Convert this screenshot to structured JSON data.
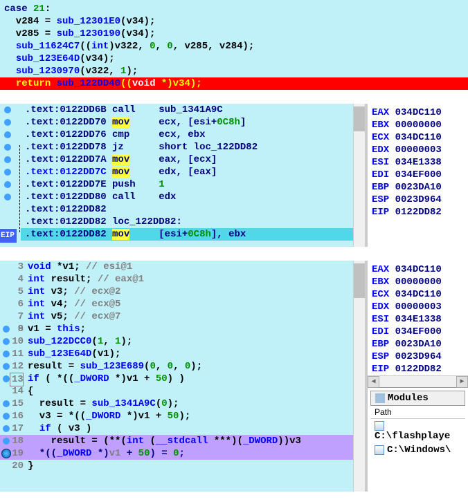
{
  "decompile_top": [
    {
      "tokens": [
        {
          "t": "case ",
          "c": "dblue"
        },
        {
          "t": "21",
          "c": "green"
        },
        {
          "t": ":",
          "c": "black"
        }
      ]
    },
    {
      "tokens": [
        {
          "t": "  v284 = ",
          "c": "black"
        },
        {
          "t": "sub_12301E0",
          "c": "blue"
        },
        {
          "t": "(v34);",
          "c": "black"
        }
      ]
    },
    {
      "tokens": [
        {
          "t": "  v285 = ",
          "c": "black"
        },
        {
          "t": "sub_1230190",
          "c": "blue"
        },
        {
          "t": "(v34);",
          "c": "black"
        }
      ]
    },
    {
      "tokens": [
        {
          "t": "  ",
          "c": "black"
        },
        {
          "t": "sub_11624C7",
          "c": "blue"
        },
        {
          "t": "((",
          "c": "black"
        },
        {
          "t": "int",
          "c": "blue"
        },
        {
          "t": ")v322, ",
          "c": "black"
        },
        {
          "t": "0",
          "c": "green"
        },
        {
          "t": ", ",
          "c": "black"
        },
        {
          "t": "0",
          "c": "green"
        },
        {
          "t": ", v285, v284);",
          "c": "black"
        }
      ]
    },
    {
      "tokens": [
        {
          "t": "  ",
          "c": "black"
        },
        {
          "t": "sub_123E64D",
          "c": "blue"
        },
        {
          "t": "(v34);",
          "c": "black"
        }
      ]
    },
    {
      "tokens": [
        {
          "t": "  ",
          "c": "black"
        },
        {
          "t": "sub_1230970",
          "c": "blue"
        },
        {
          "t": "(v322, ",
          "c": "black"
        },
        {
          "t": "1",
          "c": "green"
        },
        {
          "t": ");",
          "c": "black"
        }
      ]
    },
    {
      "tokens": [
        {
          "t": "  ",
          "c": "yellow",
          "hl": "hl-red"
        },
        {
          "t": "return ",
          "c": "yellow",
          "hl": "hl-red"
        },
        {
          "t": "sub_122DD40",
          "c": "blue",
          "hl": "hl-red"
        },
        {
          "t": "((",
          "c": "yellow",
          "hl": "hl-red"
        },
        {
          "t": "void ",
          "c": "white",
          "hl": "hl-red"
        },
        {
          "t": "*)v34);",
          "c": "yellow",
          "hl": "hl-red"
        }
      ],
      "full_hl": "hl-red"
    }
  ],
  "disasm": [
    {
      "addr": ".text:0122DD6B",
      "op": "call",
      "args": "sub_1341A9C",
      "bp": true
    },
    {
      "addr": ".text:0122DD70",
      "op": "mov",
      "hlop": true,
      "args": "ecx, [esi+",
      "suffix": "0C8h",
      "suffixc": "green",
      "end": "]",
      "bp": true
    },
    {
      "addr": ".text:0122DD76",
      "op": "cmp",
      "args": "ecx, ebx",
      "bp": true
    },
    {
      "addr": ".text:0122DD78",
      "op": "jz",
      "args": "short loc_122DD82",
      "bp": true,
      "jmp": true
    },
    {
      "addr": ".text:0122DD7A",
      "op": "mov",
      "hlop": true,
      "args": "eax, [ecx]",
      "bp": true
    },
    {
      "addr": ".text:0122DD7C",
      "op": "mov",
      "hlop": true,
      "args": "edx, [eax]",
      "bp": true,
      "blueaddr": true
    },
    {
      "addr": ".text:0122DD7E",
      "op": "push",
      "args": "1",
      "argsc": "green",
      "bp": true
    },
    {
      "addr": ".text:0122DD80",
      "op": "call",
      "args": "edx",
      "bp": true
    },
    {
      "addr": ".text:0122DD82",
      "plain": true
    },
    {
      "addr": ".text:0122DD82",
      "label": "loc_122DD82:",
      "arrow": true
    },
    {
      "addr": ".text:0122DD82",
      "op": "mov",
      "hlop": true,
      "args": "[esi+",
      "suffix": "0C8h",
      "suffixc": "green",
      "end": "], ebx",
      "line_hl": "hl-cyan",
      "eip": true
    }
  ],
  "registers_top": [
    {
      "n": "EAX",
      "v": "034DC110"
    },
    {
      "n": "EBX",
      "v": "00000000"
    },
    {
      "n": "ECX",
      "v": "034DC110"
    },
    {
      "n": "EDX",
      "v": "00000003"
    },
    {
      "n": "ESI",
      "v": "034E1338"
    },
    {
      "n": "EDI",
      "v": "034EF000"
    },
    {
      "n": "EBP",
      "v": "0023DA10"
    },
    {
      "n": "ESP",
      "v": "0023D964"
    },
    {
      "n": "EIP",
      "v": "0122DD82"
    }
  ],
  "decompile_bottom": [
    {
      "ln": "3",
      "tokens": [
        {
          "t": "void ",
          "c": "blue"
        },
        {
          "t": "*v1; ",
          "c": "black"
        },
        {
          "t": "// esi@1",
          "c": "gray"
        }
      ]
    },
    {
      "ln": "4",
      "tokens": [
        {
          "t": "int ",
          "c": "blue"
        },
        {
          "t": "result; ",
          "c": "black"
        },
        {
          "t": "// eax@1",
          "c": "gray"
        }
      ]
    },
    {
      "ln": "5",
      "tokens": [
        {
          "t": "int ",
          "c": "blue"
        },
        {
          "t": "v3; ",
          "c": "black"
        },
        {
          "t": "// ecx@2",
          "c": "gray"
        }
      ]
    },
    {
      "ln": "6",
      "tokens": [
        {
          "t": "int ",
          "c": "blue"
        },
        {
          "t": "v4; ",
          "c": "black"
        },
        {
          "t": "// ecx@5",
          "c": "gray"
        }
      ]
    },
    {
      "ln": "7",
      "tokens": [
        {
          "t": "int ",
          "c": "blue"
        },
        {
          "t": "v5; ",
          "c": "black"
        },
        {
          "t": "// ecx@7",
          "c": "gray"
        }
      ]
    },
    {
      "ln": "8",
      "tokens": []
    },
    {
      "ln": "9",
      "bp": true,
      "tokens": [
        {
          "t": "v1 = ",
          "c": "black"
        },
        {
          "t": "this",
          "c": "blue"
        },
        {
          "t": ";",
          "c": "black"
        }
      ]
    },
    {
      "ln": "10",
      "bp": true,
      "tokens": [
        {
          "t": "sub_122DCC0",
          "c": "blue"
        },
        {
          "t": "(",
          "c": "black"
        },
        {
          "t": "1",
          "c": "green"
        },
        {
          "t": ", ",
          "c": "black"
        },
        {
          "t": "1",
          "c": "green"
        },
        {
          "t": ");",
          "c": "black"
        }
      ]
    },
    {
      "ln": "11",
      "bp": true,
      "tokens": [
        {
          "t": "sub_123E64D",
          "c": "blue"
        },
        {
          "t": "(v1);",
          "c": "black"
        }
      ]
    },
    {
      "ln": "12",
      "bp": true,
      "tokens": [
        {
          "t": "result = ",
          "c": "black"
        },
        {
          "t": "sub_123E689",
          "c": "blue"
        },
        {
          "t": "(",
          "c": "black"
        },
        {
          "t": "0",
          "c": "green"
        },
        {
          "t": ", ",
          "c": "black"
        },
        {
          "t": "0",
          "c": "green"
        },
        {
          "t": ", ",
          "c": "black"
        },
        {
          "t": "0",
          "c": "green"
        },
        {
          "t": ");",
          "c": "black"
        }
      ]
    },
    {
      "ln": "13",
      "bp": true,
      "box": true,
      "tokens": [
        {
          "t": "if ",
          "c": "blue"
        },
        {
          "t": "( *((",
          "c": "black"
        },
        {
          "t": "_DWORD ",
          "c": "blue"
        },
        {
          "t": "*)v1 + ",
          "c": "black"
        },
        {
          "t": "50",
          "c": "green"
        },
        {
          "t": ") )",
          "c": "black"
        }
      ]
    },
    {
      "ln": "14",
      "tokens": [
        {
          "t": "{",
          "c": "black"
        }
      ]
    },
    {
      "ln": "15",
      "bp": true,
      "tokens": [
        {
          "t": "  result = ",
          "c": "black"
        },
        {
          "t": "sub_1341A9C",
          "c": "blue"
        },
        {
          "t": "(",
          "c": "black"
        },
        {
          "t": "0",
          "c": "green"
        },
        {
          "t": ");",
          "c": "black"
        }
      ]
    },
    {
      "ln": "16",
      "bp": true,
      "tokens": [
        {
          "t": "  v3 = *((",
          "c": "black"
        },
        {
          "t": "_DWORD ",
          "c": "blue"
        },
        {
          "t": "*)v1 + ",
          "c": "black"
        },
        {
          "t": "50",
          "c": "green"
        },
        {
          "t": ");",
          "c": "black"
        }
      ]
    },
    {
      "ln": "17",
      "bp": true,
      "tokens": [
        {
          "t": "  ",
          "c": "black"
        },
        {
          "t": "if ",
          "c": "blue"
        },
        {
          "t": "( v3 )",
          "c": "black"
        }
      ]
    },
    {
      "ln": "18",
      "bp": true,
      "hl": "hl-purple",
      "tokens": [
        {
          "t": "    result = (**(",
          "c": "black"
        },
        {
          "t": "int ",
          "c": "blue"
        },
        {
          "t": "(",
          "c": "black"
        },
        {
          "t": "__stdcall ",
          "c": "blue"
        },
        {
          "t": "***)(",
          "c": "black"
        },
        {
          "t": "_DWORD",
          "c": "blue"
        },
        {
          "t": "))v3",
          "c": "black"
        }
      ]
    },
    {
      "ln": "19",
      "bp": true,
      "bigbp": true,
      "hl": "hl-purple",
      "tokens": [
        {
          "t": "  *((",
          "c": "dblue"
        },
        {
          "t": "_DWORD ",
          "c": "blue"
        },
        {
          "t": "*)",
          "c": "dblue"
        },
        {
          "t": "v1",
          "c": "gray"
        },
        {
          "t": " + ",
          "c": "dblue"
        },
        {
          "t": "50",
          "c": "green"
        },
        {
          "t": ") = ",
          "c": "dblue"
        },
        {
          "t": "0",
          "c": "green"
        },
        {
          "t": ";",
          "c": "dblue"
        }
      ]
    },
    {
      "ln": "20",
      "tokens": [
        {
          "t": "}",
          "c": "black"
        }
      ]
    }
  ],
  "registers_bottom": [
    {
      "n": "EAX",
      "v": "034DC110"
    },
    {
      "n": "EBX",
      "v": "00000000"
    },
    {
      "n": "ECX",
      "v": "034DC110"
    },
    {
      "n": "EDX",
      "v": "00000003"
    },
    {
      "n": "ESI",
      "v": "034E1338"
    },
    {
      "n": "EDI",
      "v": "034EF000"
    },
    {
      "n": "EBP",
      "v": "0023DA10"
    },
    {
      "n": "ESP",
      "v": "0023D964"
    },
    {
      "n": "EIP",
      "v": "0122DD82"
    }
  ],
  "modules": {
    "header": "Modules",
    "path_header": "Path",
    "paths": [
      "C:\\flashplaye",
      "C:\\Windows\\"
    ]
  },
  "eip_label": "EIP"
}
